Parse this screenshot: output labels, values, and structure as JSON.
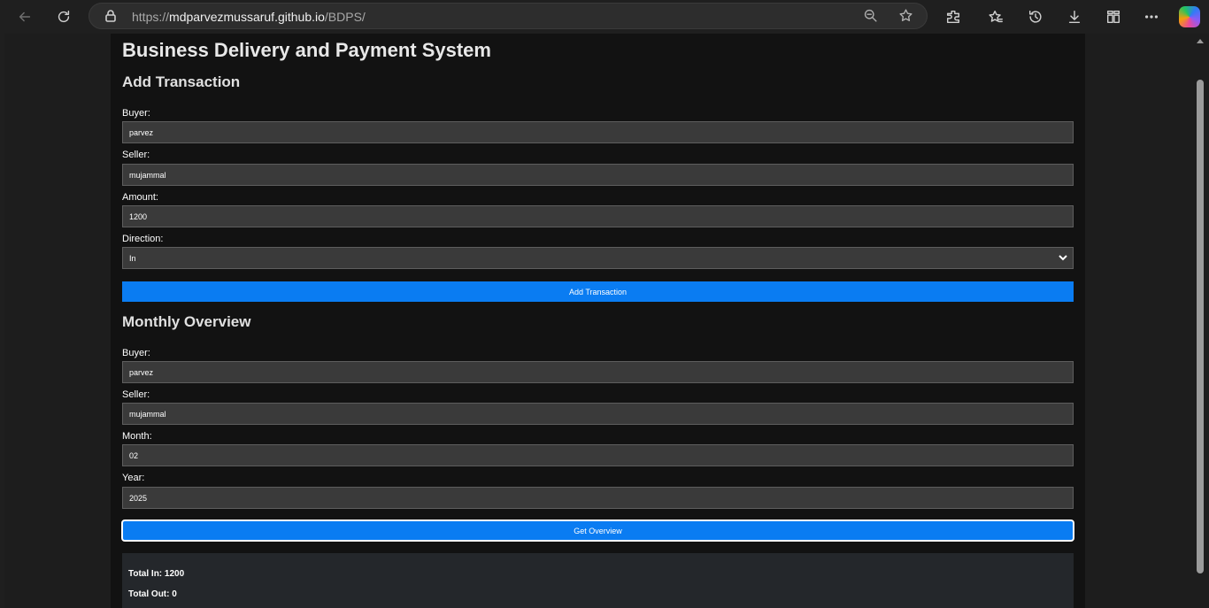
{
  "browser": {
    "url_prefix": "https://",
    "url_domain": "mdparvezmussaruf.github.io",
    "url_path": "/BDPS/",
    "icons": [
      "back-icon",
      "refresh-icon",
      "lock-icon",
      "zoom-icon",
      "star-icon",
      "extensions-icon",
      "favorites-icon",
      "history-icon",
      "downloads-icon",
      "collections-icon",
      "more-icon",
      "copilot-icon"
    ]
  },
  "page": {
    "title": "Business Delivery and Payment System",
    "add_transaction": {
      "heading": "Add Transaction",
      "buyer_label": "Buyer:",
      "buyer_value": "parvez",
      "seller_label": "Seller:",
      "seller_value": "mujammal",
      "amount_label": "Amount:",
      "amount_value": "1200",
      "direction_label": "Direction:",
      "direction_value": "In",
      "button": "Add Transaction"
    },
    "monthly_overview": {
      "heading": "Monthly Overview",
      "buyer_label": "Buyer:",
      "buyer_value": "parvez",
      "seller_label": "Seller:",
      "seller_value": "mujammal",
      "month_label": "Month:",
      "month_value": "02",
      "year_label": "Year:",
      "year_value": "2025",
      "button": "Get Overview"
    },
    "result": {
      "total_in": "Total In: 1200",
      "total_out": "Total Out: 0"
    }
  },
  "colors": {
    "accent": "#0a7cf2",
    "page_bg": "#121212",
    "field_bg": "#3a3a3a"
  }
}
